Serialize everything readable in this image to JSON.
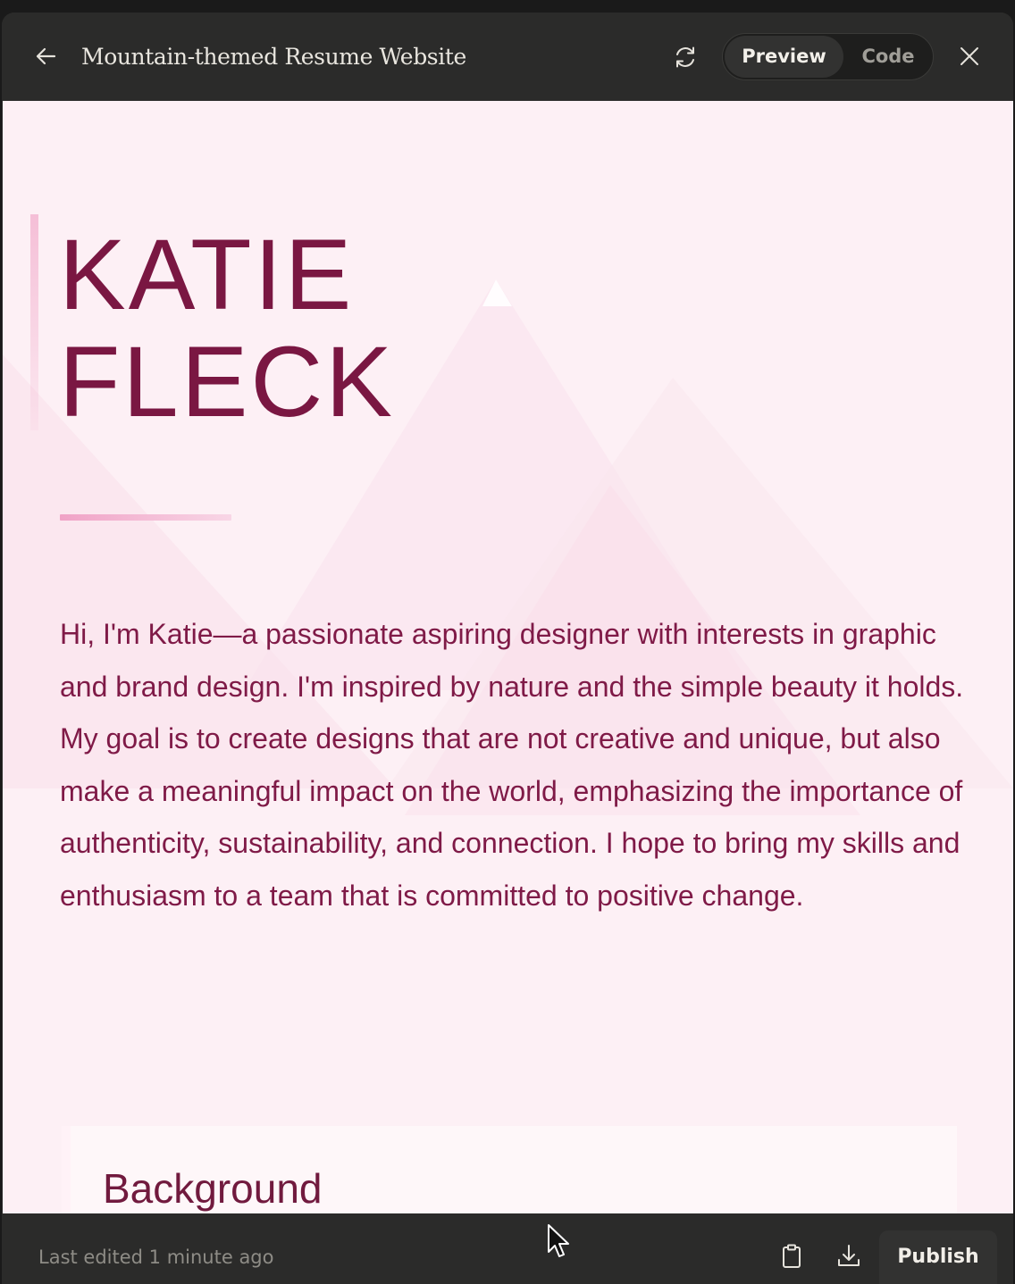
{
  "header": {
    "title": "Mountain-themed Resume Website",
    "preview_label": "Preview",
    "code_label": "Code",
    "active_tab": "Preview"
  },
  "preview": {
    "name_line1": "KATIE",
    "name_line2": "FLECK",
    "bio": "Hi, I'm Katie—a passionate aspiring designer with interests in graphic and brand design. I'm inspired by nature and the simple beauty it holds. My goal is to create designs that are not creative and unique, but also make a meaningful impact on the world, emphasizing the importance of authenticity, sustainability, and connection. I hope to bring my skills and enthusiasm to a team that is committed to positive change.",
    "section_heading": "Background"
  },
  "footer": {
    "last_edited": "Last edited 1 minute ago",
    "publish_label": "Publish"
  },
  "icons": {
    "back": "arrow-left-icon",
    "refresh": "refresh-icon",
    "close": "close-icon",
    "copy": "clipboard-icon",
    "download": "download-icon"
  },
  "colors": {
    "chrome_bg": "#2b2b2a",
    "preview_bg": "#fdf0f5",
    "name_color": "#7a1742",
    "bio_color": "#7f1a47",
    "accent_pink": "#f0a2c6"
  }
}
